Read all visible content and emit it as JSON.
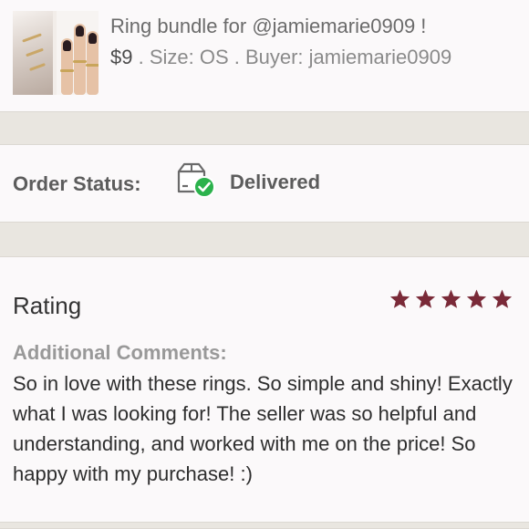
{
  "listing": {
    "title": "Ring bundle for @jamiemarie0909 !",
    "price": "$9",
    "meta": " . Size: OS . Buyer: jamiemarie0909"
  },
  "order": {
    "status_label": "Order Status:",
    "status_icon": "package-delivered-icon",
    "status_value": "Delivered"
  },
  "rating": {
    "title": "Rating",
    "stars": 5,
    "star_color": "#7a2a38",
    "comments_label": "Additional Comments:",
    "comments": "So in love with these rings. So simple and shiny! Exactly what I was looking for! The seller was so helpful and understanding, and worked with me on the price! So happy with my purchase! :)"
  },
  "colors": {
    "check_green": "#2bb24c",
    "background": "#e9e6e0"
  }
}
